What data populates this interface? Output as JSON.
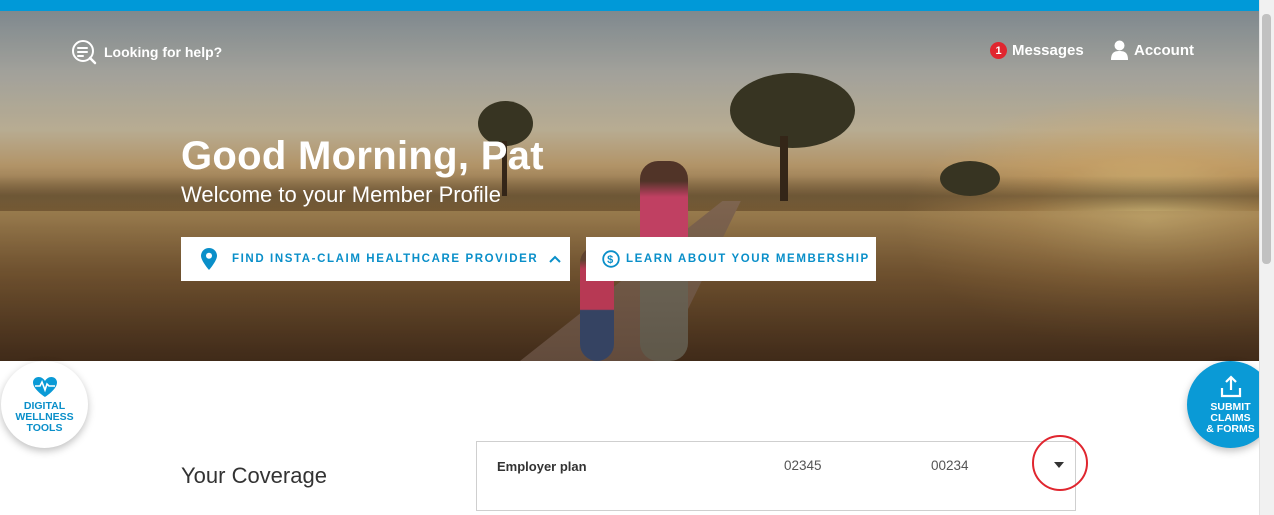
{
  "header": {
    "help_label": "Looking for help?",
    "messages_badge": "1",
    "messages_label": "Messages",
    "account_label": "Account"
  },
  "hero": {
    "greeting": "Good Morning, Pat",
    "subtitle": "Welcome to your Member Profile",
    "provider_button": "FIND INSTA-CLAIM HEALTHCARE PROVIDER",
    "membership_button": "LEARN ABOUT YOUR MEMBERSHIP"
  },
  "floating": {
    "wellness_line1": "DIGITAL",
    "wellness_line2": "WELLNESS",
    "wellness_line3": "TOOLS",
    "submit_line1": "SUBMIT",
    "submit_line2": "CLAIMS",
    "submit_line3": "& FORMS"
  },
  "coverage": {
    "title": "Your Coverage",
    "plan_name": "Employer plan",
    "plan_number_1": "02345",
    "plan_number_2": "00234"
  },
  "colors": {
    "accent": "#0a9ad6",
    "top_bar": "#0099d8",
    "badge": "#e0262f",
    "highlight": "#e0262f"
  },
  "icons": [
    "search-help-icon",
    "user-icon",
    "location-pin-icon",
    "chevron-up-icon",
    "dollar-circle-icon",
    "heart-pulse-icon",
    "upload-icon",
    "caret-down-icon"
  ]
}
